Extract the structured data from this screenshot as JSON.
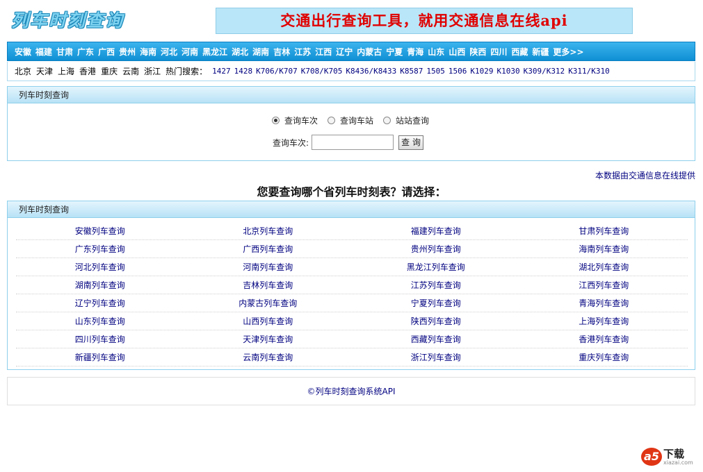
{
  "header": {
    "logo": "列车时刻查询",
    "banner": "交通出行查询工具，就用交通信息在线api"
  },
  "provinces": [
    "安徽",
    "福建",
    "甘肃",
    "广东",
    "广西",
    "贵州",
    "海南",
    "河北",
    "河南",
    "黑龙江",
    "湖北",
    "湖南",
    "吉林",
    "江苏",
    "江西",
    "辽宁",
    "内蒙古",
    "宁夏",
    "青海",
    "山东",
    "山西",
    "陕西",
    "四川",
    "西藏",
    "新疆",
    "更多>>"
  ],
  "hot": {
    "cities": [
      "北京",
      "天津",
      "上海",
      "香港",
      "重庆",
      "云南",
      "浙江"
    ],
    "label": "热门搜索：",
    "trains": [
      "1427",
      "1428",
      "K706/K707",
      "K708/K705",
      "K8436/K8433",
      "K8587",
      "1505",
      "1506",
      "K1029",
      "K1030",
      "K309/K312",
      "K311/K310"
    ]
  },
  "query_panel": {
    "title": "列车时刻查询",
    "radios": [
      {
        "label": "查询车次",
        "checked": true
      },
      {
        "label": "查询车站",
        "checked": false
      },
      {
        "label": "站站查询",
        "checked": false
      }
    ],
    "field_label": "查询车次:",
    "input_value": "",
    "button": "查 询"
  },
  "source_note": "本数据由交通信息在线提供",
  "ask": "您要查询哪个省列车时刻表？请选择：",
  "province_panel": {
    "title": "列车时刻查询",
    "rows": [
      [
        "安徽列车查询",
        "北京列车查询",
        "福建列车查询",
        "甘肃列车查询"
      ],
      [
        "广东列车查询",
        "广西列车查询",
        "贵州列车查询",
        "海南列车查询"
      ],
      [
        "河北列车查询",
        "河南列车查询",
        "黑龙江列车查询",
        "湖北列车查询"
      ],
      [
        "湖南列车查询",
        "吉林列车查询",
        "江苏列车查询",
        "江西列车查询"
      ],
      [
        "辽宁列车查询",
        "内蒙古列车查询",
        "宁夏列车查询",
        "青海列车查询"
      ],
      [
        "山东列车查询",
        "山西列车查询",
        "陕西列车查询",
        "上海列车查询"
      ],
      [
        "四川列车查询",
        "天津列车查询",
        "西藏列车查询",
        "香港列车查询"
      ],
      [
        "新疆列车查询",
        "云南列车查询",
        "浙江列车查询",
        "重庆列车查询"
      ]
    ]
  },
  "footer": "©列车时刻查询系统API",
  "watermark": {
    "mark": "a5",
    "text": "下载",
    "url": "xiazai.com"
  }
}
